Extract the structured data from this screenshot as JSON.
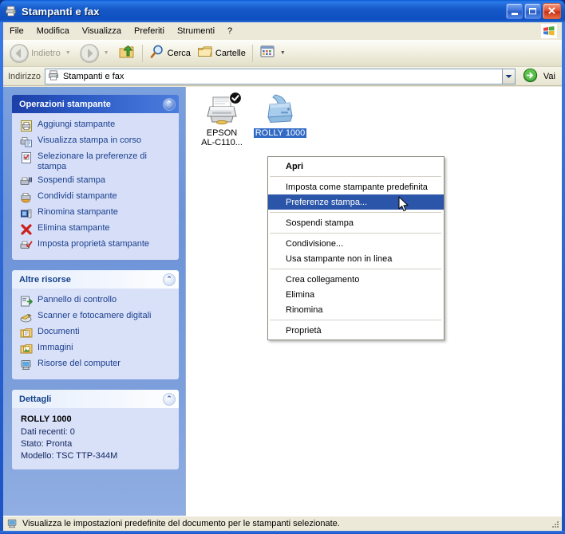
{
  "window": {
    "title": "Stampanti e fax",
    "title_icon": "printer-fax-icon",
    "minimize_label": "",
    "maximize_label": "",
    "close_label": "✕"
  },
  "menubar": {
    "items": [
      {
        "label": "File",
        "name": "menu-file"
      },
      {
        "label": "Modifica",
        "name": "menu-modifica"
      },
      {
        "label": "Visualizza",
        "name": "menu-visualizza"
      },
      {
        "label": "Preferiti",
        "name": "menu-preferiti"
      },
      {
        "label": "Strumenti",
        "name": "menu-strumenti"
      },
      {
        "label": "?",
        "name": "menu-help"
      }
    ],
    "brand_icon": "windows-flag-icon"
  },
  "toolbar": {
    "back_label": "Indietro",
    "back_icon": "arrow-left-icon",
    "forward_icon": "arrow-right-icon",
    "up_icon": "folder-up-icon",
    "search_label": "Cerca",
    "search_icon": "magnifier-icon",
    "folders_label": "Cartelle",
    "folders_icon": "folder-icon",
    "views_icon": "views-icon",
    "dropdown_glyph": "▼"
  },
  "address": {
    "label": "Indirizzo",
    "value": "Stampanti e fax",
    "icon": "printer-fax-icon",
    "dropdown_glyph": "▼",
    "go_label": "Vai",
    "go_icon": "go-arrow-icon"
  },
  "sidebar": {
    "panels": [
      {
        "name": "printer-tasks-panel",
        "style": "blue",
        "title": "Operazioni stampante",
        "collapse_glyph": "⌃",
        "items": [
          {
            "label": "Aggiungi stampante",
            "icon": "add-printer-icon",
            "name": "sidebar-item-aggiungi-stampante"
          },
          {
            "label": "Visualizza stampa in corso",
            "icon": "print-queue-icon",
            "name": "sidebar-item-visualizza-stampa"
          },
          {
            "label": "Selezionare la preferenze di stampa",
            "icon": "printing-preferences-icon",
            "name": "sidebar-item-preferenze-stampa"
          },
          {
            "label": "Sospendi stampa",
            "icon": "pause-print-icon",
            "name": "sidebar-item-sospendi-stampa"
          },
          {
            "label": "Condividi stampante",
            "icon": "share-printer-icon",
            "name": "sidebar-item-condividi-stampante"
          },
          {
            "label": "Rinomina stampante",
            "icon": "rename-printer-icon",
            "name": "sidebar-item-rinomina-stampante"
          },
          {
            "label": "Elimina stampante",
            "icon": "delete-red-x-icon",
            "name": "sidebar-item-elimina-stampante"
          },
          {
            "label": "Imposta proprietà stampante",
            "icon": "printer-properties-icon",
            "name": "sidebar-item-imposta-proprieta"
          }
        ]
      },
      {
        "name": "other-places-panel",
        "style": "light",
        "title": "Altre risorse",
        "collapse_glyph": "⌃",
        "items": [
          {
            "label": "Pannello di controllo",
            "icon": "control-panel-icon",
            "name": "sidebar-item-pannello-di-controllo"
          },
          {
            "label": "Scanner e fotocamere digitali",
            "icon": "scanner-camera-icon",
            "name": "sidebar-item-scanner-fotocamere"
          },
          {
            "label": "Documenti",
            "icon": "documents-folder-icon",
            "name": "sidebar-item-documenti"
          },
          {
            "label": "Immagini",
            "icon": "pictures-folder-icon",
            "name": "sidebar-item-immagini"
          },
          {
            "label": "Risorse del computer",
            "icon": "my-computer-icon",
            "name": "sidebar-item-risorse-del-computer"
          }
        ]
      },
      {
        "name": "details-panel",
        "style": "light",
        "title": "Dettagli",
        "collapse_glyph": "⌃",
        "lines": [
          "ROLLY 1000",
          "Dati recenti: 0",
          "Stato: Pronta",
          "Modello: TSC TTP-344M"
        ]
      }
    ]
  },
  "content": {
    "printers": [
      {
        "name": "printer-epson",
        "label_line1": "EPSON",
        "label_line2": "AL-C110...",
        "icon": "printer-icon",
        "default_badge": "check-badge-icon",
        "is_default": true,
        "selected": false
      },
      {
        "name": "printer-rolly-1000",
        "label_line1": "ROLLY 1000",
        "label_line2": "",
        "icon": "printer-icon",
        "is_default": false,
        "selected": true
      }
    ]
  },
  "context_menu": {
    "name": "printer-context-menu",
    "groups": [
      [
        {
          "label": "Apri",
          "bold": true,
          "selected": false,
          "name": "ctx-apri"
        }
      ],
      [
        {
          "label": "Imposta come stampante predefinita",
          "bold": false,
          "selected": false,
          "name": "ctx-imposta-predefinita"
        },
        {
          "label": "Preferenze stampa...",
          "bold": false,
          "selected": true,
          "name": "ctx-preferenze-stampa"
        }
      ],
      [
        {
          "label": "Sospendi stampa",
          "bold": false,
          "selected": false,
          "name": "ctx-sospendi-stampa"
        }
      ],
      [
        {
          "label": "Condivisione...",
          "bold": false,
          "selected": false,
          "name": "ctx-condivisione"
        },
        {
          "label": "Usa stampante non in linea",
          "bold": false,
          "selected": false,
          "name": "ctx-usa-non-in-linea"
        }
      ],
      [
        {
          "label": "Crea collegamento",
          "bold": false,
          "selected": false,
          "name": "ctx-crea-collegamento"
        },
        {
          "label": "Elimina",
          "bold": false,
          "selected": false,
          "name": "ctx-elimina"
        },
        {
          "label": "Rinomina",
          "bold": false,
          "selected": false,
          "name": "ctx-rinomina"
        }
      ],
      [
        {
          "label": "Proprietà",
          "bold": false,
          "selected": false,
          "name": "ctx-proprieta"
        }
      ]
    ]
  },
  "statusbar": {
    "text": "Visualizza le impostazioni predefinite del documento per le stampanti selezionate.",
    "icon": "my-computer-icon"
  },
  "colors": {
    "titlebar_blue": "#1c52c4",
    "sidebar_blue": "#7ba0dd",
    "panel_body": "#d6dff7",
    "selection_blue": "#2a55a8",
    "link_blue": "#1a3e8f",
    "chrome_beige": "#ece9d8"
  }
}
